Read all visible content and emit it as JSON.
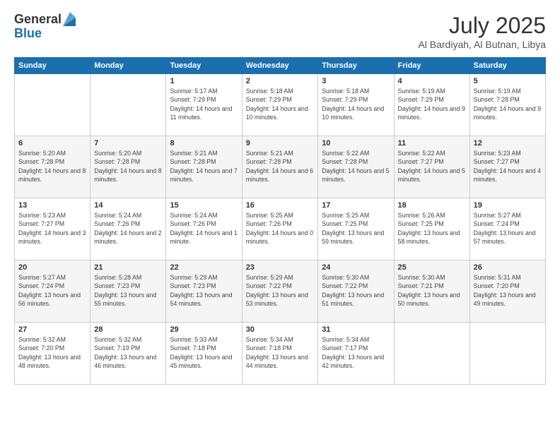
{
  "logo": {
    "general": "General",
    "blue": "Blue"
  },
  "header": {
    "month": "July 2025",
    "location": "Al Bardiyah, Al Butnan, Libya"
  },
  "days_of_week": [
    "Sunday",
    "Monday",
    "Tuesday",
    "Wednesday",
    "Thursday",
    "Friday",
    "Saturday"
  ],
  "weeks": [
    [
      {
        "day": "",
        "sunrise": "",
        "sunset": "",
        "daylight": ""
      },
      {
        "day": "",
        "sunrise": "",
        "sunset": "",
        "daylight": ""
      },
      {
        "day": "1",
        "sunrise": "Sunrise: 5:17 AM",
        "sunset": "Sunset: 7:29 PM",
        "daylight": "Daylight: 14 hours and 11 minutes."
      },
      {
        "day": "2",
        "sunrise": "Sunrise: 5:18 AM",
        "sunset": "Sunset: 7:29 PM",
        "daylight": "Daylight: 14 hours and 10 minutes."
      },
      {
        "day": "3",
        "sunrise": "Sunrise: 5:18 AM",
        "sunset": "Sunset: 7:29 PM",
        "daylight": "Daylight: 14 hours and 10 minutes."
      },
      {
        "day": "4",
        "sunrise": "Sunrise: 5:19 AM",
        "sunset": "Sunset: 7:29 PM",
        "daylight": "Daylight: 14 hours and 9 minutes."
      },
      {
        "day": "5",
        "sunrise": "Sunrise: 5:19 AM",
        "sunset": "Sunset: 7:28 PM",
        "daylight": "Daylight: 14 hours and 9 minutes."
      }
    ],
    [
      {
        "day": "6",
        "sunrise": "Sunrise: 5:20 AM",
        "sunset": "Sunset: 7:28 PM",
        "daylight": "Daylight: 14 hours and 8 minutes."
      },
      {
        "day": "7",
        "sunrise": "Sunrise: 5:20 AM",
        "sunset": "Sunset: 7:28 PM",
        "daylight": "Daylight: 14 hours and 8 minutes."
      },
      {
        "day": "8",
        "sunrise": "Sunrise: 5:21 AM",
        "sunset": "Sunset: 7:28 PM",
        "daylight": "Daylight: 14 hours and 7 minutes."
      },
      {
        "day": "9",
        "sunrise": "Sunrise: 5:21 AM",
        "sunset": "Sunset: 7:28 PM",
        "daylight": "Daylight: 14 hours and 6 minutes."
      },
      {
        "day": "10",
        "sunrise": "Sunrise: 5:22 AM",
        "sunset": "Sunset: 7:28 PM",
        "daylight": "Daylight: 14 hours and 5 minutes."
      },
      {
        "day": "11",
        "sunrise": "Sunrise: 5:22 AM",
        "sunset": "Sunset: 7:27 PM",
        "daylight": "Daylight: 14 hours and 5 minutes."
      },
      {
        "day": "12",
        "sunrise": "Sunrise: 5:23 AM",
        "sunset": "Sunset: 7:27 PM",
        "daylight": "Daylight: 14 hours and 4 minutes."
      }
    ],
    [
      {
        "day": "13",
        "sunrise": "Sunrise: 5:23 AM",
        "sunset": "Sunset: 7:27 PM",
        "daylight": "Daylight: 14 hours and 3 minutes."
      },
      {
        "day": "14",
        "sunrise": "Sunrise: 5:24 AM",
        "sunset": "Sunset: 7:26 PM",
        "daylight": "Daylight: 14 hours and 2 minutes."
      },
      {
        "day": "15",
        "sunrise": "Sunrise: 5:24 AM",
        "sunset": "Sunset: 7:26 PM",
        "daylight": "Daylight: 14 hours and 1 minute."
      },
      {
        "day": "16",
        "sunrise": "Sunrise: 5:25 AM",
        "sunset": "Sunset: 7:26 PM",
        "daylight": "Daylight: 14 hours and 0 minutes."
      },
      {
        "day": "17",
        "sunrise": "Sunrise: 5:25 AM",
        "sunset": "Sunset: 7:25 PM",
        "daylight": "Daylight: 13 hours and 59 minutes."
      },
      {
        "day": "18",
        "sunrise": "Sunrise: 5:26 AM",
        "sunset": "Sunset: 7:25 PM",
        "daylight": "Daylight: 13 hours and 58 minutes."
      },
      {
        "day": "19",
        "sunrise": "Sunrise: 5:27 AM",
        "sunset": "Sunset: 7:24 PM",
        "daylight": "Daylight: 13 hours and 57 minutes."
      }
    ],
    [
      {
        "day": "20",
        "sunrise": "Sunrise: 5:27 AM",
        "sunset": "Sunset: 7:24 PM",
        "daylight": "Daylight: 13 hours and 56 minutes."
      },
      {
        "day": "21",
        "sunrise": "Sunrise: 5:28 AM",
        "sunset": "Sunset: 7:23 PM",
        "daylight": "Daylight: 13 hours and 55 minutes."
      },
      {
        "day": "22",
        "sunrise": "Sunrise: 5:29 AM",
        "sunset": "Sunset: 7:23 PM",
        "daylight": "Daylight: 13 hours and 54 minutes."
      },
      {
        "day": "23",
        "sunrise": "Sunrise: 5:29 AM",
        "sunset": "Sunset: 7:22 PM",
        "daylight": "Daylight: 13 hours and 53 minutes."
      },
      {
        "day": "24",
        "sunrise": "Sunrise: 5:30 AM",
        "sunset": "Sunset: 7:22 PM",
        "daylight": "Daylight: 13 hours and 51 minutes."
      },
      {
        "day": "25",
        "sunrise": "Sunrise: 5:30 AM",
        "sunset": "Sunset: 7:21 PM",
        "daylight": "Daylight: 13 hours and 50 minutes."
      },
      {
        "day": "26",
        "sunrise": "Sunrise: 5:31 AM",
        "sunset": "Sunset: 7:20 PM",
        "daylight": "Daylight: 13 hours and 49 minutes."
      }
    ],
    [
      {
        "day": "27",
        "sunrise": "Sunrise: 5:32 AM",
        "sunset": "Sunset: 7:20 PM",
        "daylight": "Daylight: 13 hours and 48 minutes."
      },
      {
        "day": "28",
        "sunrise": "Sunrise: 5:32 AM",
        "sunset": "Sunset: 7:19 PM",
        "daylight": "Daylight: 13 hours and 46 minutes."
      },
      {
        "day": "29",
        "sunrise": "Sunrise: 5:33 AM",
        "sunset": "Sunset: 7:18 PM",
        "daylight": "Daylight: 13 hours and 45 minutes."
      },
      {
        "day": "30",
        "sunrise": "Sunrise: 5:34 AM",
        "sunset": "Sunset: 7:18 PM",
        "daylight": "Daylight: 13 hours and 44 minutes."
      },
      {
        "day": "31",
        "sunrise": "Sunrise: 5:34 AM",
        "sunset": "Sunset: 7:17 PM",
        "daylight": "Daylight: 13 hours and 42 minutes."
      },
      {
        "day": "",
        "sunrise": "",
        "sunset": "",
        "daylight": ""
      },
      {
        "day": "",
        "sunrise": "",
        "sunset": "",
        "daylight": ""
      }
    ]
  ]
}
